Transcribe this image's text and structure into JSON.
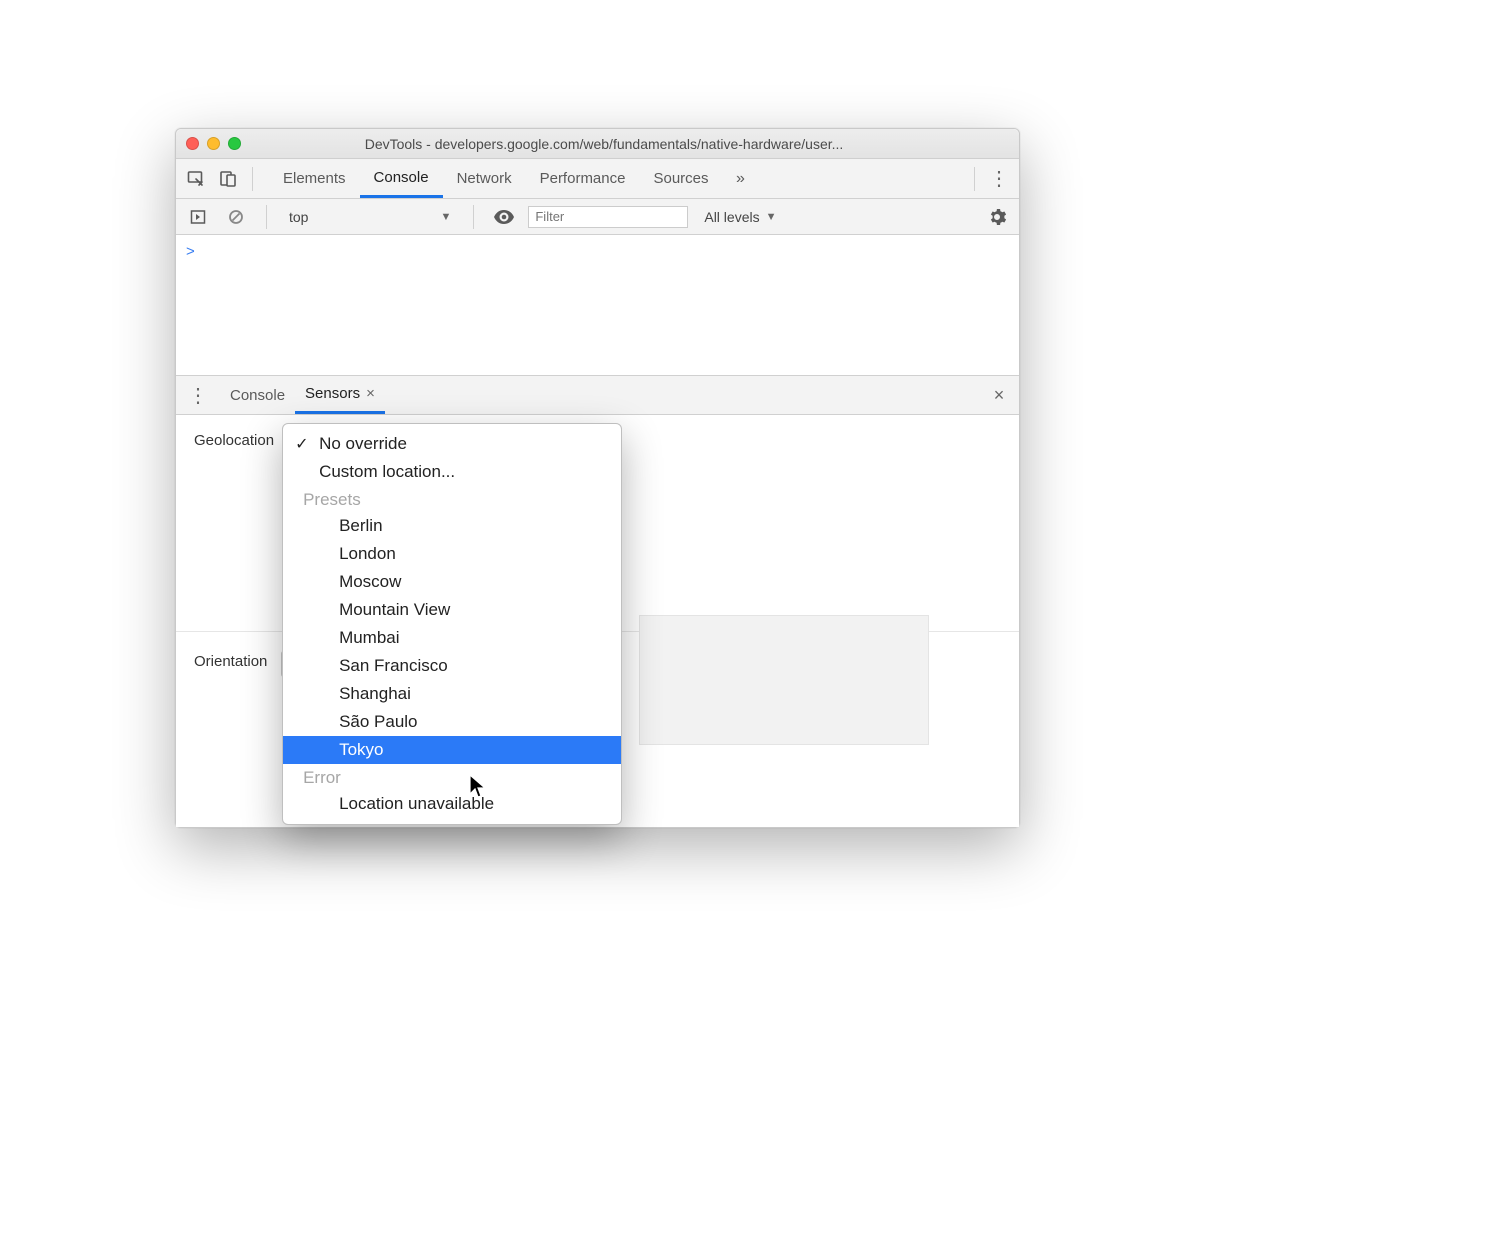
{
  "window": {
    "title": "DevTools - developers.google.com/web/fundamentals/native-hardware/user..."
  },
  "tabs": {
    "items": [
      "Elements",
      "Console",
      "Network",
      "Performance",
      "Sources"
    ],
    "active": "Console",
    "overflow_glyph": "»"
  },
  "console_toolbar": {
    "context": "top",
    "filter_placeholder": "Filter",
    "levels_label": "All levels"
  },
  "console": {
    "prompt": ">"
  },
  "drawer": {
    "tabs": [
      "Console",
      "Sensors"
    ],
    "active": "Sensors",
    "close_glyph": "×"
  },
  "sensors": {
    "geolocation_label": "Geolocation",
    "orientation_label": "Orientation",
    "dropdown": {
      "selected": "No override",
      "items_top": [
        "No override",
        "Custom location..."
      ],
      "group1_label": "Presets",
      "group1_items": [
        "Berlin",
        "London",
        "Moscow",
        "Mountain View",
        "Mumbai",
        "San Francisco",
        "Shanghai",
        "São Paulo",
        "Tokyo"
      ],
      "highlighted": "Tokyo",
      "group2_label": "Error",
      "group2_items": [
        "Location unavailable"
      ]
    }
  }
}
